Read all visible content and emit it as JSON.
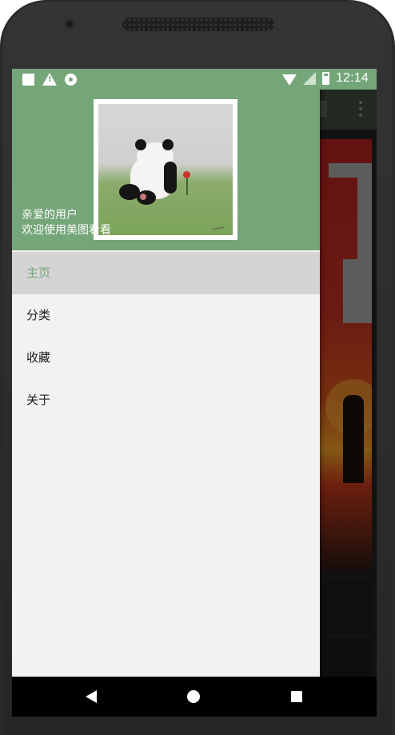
{
  "status_bar": {
    "time": "12:14",
    "icons": [
      "square-notification-icon",
      "warning-icon",
      "settings-notification-icon",
      "wifi-icon",
      "signal-icon",
      "battery-icon"
    ]
  },
  "drawer": {
    "header": {
      "avatar": "panda-avatar-image",
      "greeting_line1": "亲爱的用户",
      "greeting_line2": "欢迎使用美图看看"
    },
    "menu": [
      {
        "label": "主页",
        "active": true
      },
      {
        "label": "分类",
        "active": false
      },
      {
        "label": "收藏",
        "active": false
      },
      {
        "label": "关于",
        "active": false
      }
    ]
  },
  "nav_bar": {
    "icons": [
      "back-icon",
      "home-icon",
      "recents-icon"
    ]
  },
  "colors": {
    "primary": "#75a679",
    "drawer_bg": "#f2f2f2",
    "active_item_bg": "#d4d4d4",
    "text": "#1c1c1c"
  }
}
